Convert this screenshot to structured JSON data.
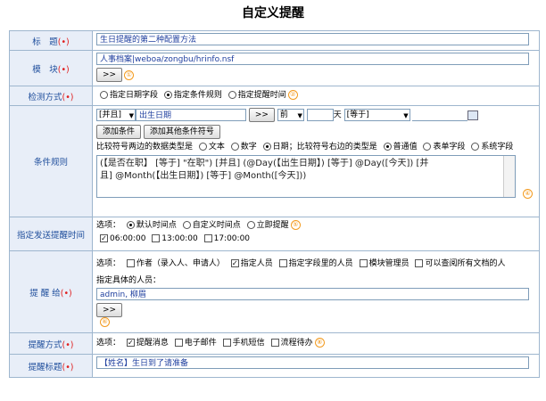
{
  "page_title": "自定义提醒",
  "title_field": {
    "label": "标　题",
    "value": "生日提醒的第二种配置方法"
  },
  "module_field": {
    "label": "模　块",
    "value": "人事档案|weboa/zongbu/hrinfo.nsf",
    "button": ">>",
    "marker": "①"
  },
  "detect_mode": {
    "label": "检测方式",
    "options": [
      "指定日期字段",
      "指定条件规则",
      "指定提醒时间"
    ],
    "selected": 1,
    "marker": "②"
  },
  "conditions": {
    "label": "条件规则",
    "connector": "[并且]",
    "field": "出生日期",
    "pick_button": ">>",
    "direction": "前",
    "day_unit": "天",
    "operator": "[等于]",
    "add_condition": "添加条件",
    "add_other": "添加其他条件符号",
    "left_type_label": "比较符号两边的数据类型是",
    "left_types": [
      "文本",
      "数字",
      "日期"
    ],
    "left_selected": 2,
    "right_type_label": "比较符号右边的类型是",
    "right_types": [
      "普通值",
      "表单字段",
      "系统字段"
    ],
    "right_selected": 0,
    "expr_line1": "(【是否在职】 [等于] \"在职\") [并且] (@Day(【出生日期】) [等于] @Day([今天]) [并",
    "expr_line2": "且] @Month(【出生日期】) [等于] @Month([今天]))",
    "marker": "④"
  },
  "send_time": {
    "label": "指定发送提醒时间",
    "options_label": "选项：",
    "options": [
      "默认时间点",
      "自定义时间点",
      "立即提醒"
    ],
    "selected": 0,
    "marker": "⑤",
    "times": [
      "06:00:00",
      "13:00:00",
      "17:00:00"
    ],
    "times_checked": [
      true,
      false,
      false
    ]
  },
  "recipients": {
    "label": "提 醒 给",
    "options_label": "选项：",
    "options": [
      "作者（录入人、申请人）",
      "指定人员",
      "指定字段里的人员",
      "模块管理员",
      "可以查阅所有文档的人"
    ],
    "checked": [
      false,
      true,
      false,
      false,
      false
    ],
    "specific_label": "指定具体的人员：",
    "specific_value": "admin, 柳眉",
    "button": ">>",
    "marker": "⑥"
  },
  "method": {
    "label": "提醒方式",
    "options_label": "选项：",
    "options": [
      "提醒消息",
      "电子邮件",
      "手机短信",
      "流程待办"
    ],
    "checked": [
      true,
      false,
      false,
      false
    ],
    "marker": "⑧"
  },
  "remind_title": {
    "label": "提醒标题",
    "value": "【姓名】生日到了请准备"
  },
  "colors": {
    "label_text": "#1f4e9c",
    "label_bg": "#e8eef8",
    "border": "#9eb6ce",
    "marker": "#f39a1e",
    "required": "#e02020"
  }
}
